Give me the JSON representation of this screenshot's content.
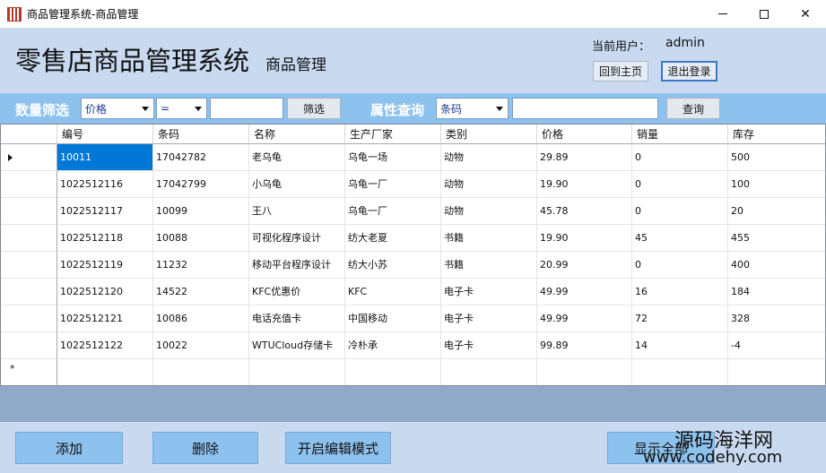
{
  "window": {
    "title": "商品管理系统-商品管理",
    "minimize_icon": "minimize-icon",
    "maximize_icon": "maximize-icon",
    "close_icon": "close-icon",
    "close_glyph": "✕"
  },
  "header": {
    "title": "零售店商品管理系统",
    "subtitle": "商品管理",
    "current_user_label": "当前用户：",
    "current_user": "admin",
    "home_button": "回到主页",
    "logout_button": "退出登录"
  },
  "filter": {
    "quantity_label": "数量筛选",
    "field_select": "价格",
    "operator_select": "=",
    "value": "",
    "filter_button": "筛选",
    "attribute_label": "属性查询",
    "attribute_select": "条码",
    "query_value": "",
    "query_button": "查询"
  },
  "grid": {
    "columns": [
      "编号",
      "条码",
      "名称",
      "生产厂家",
      "类别",
      "价格",
      "销量",
      "库存"
    ],
    "rows": [
      [
        "10011",
        "17042782",
        "老乌龟",
        "乌龟一场",
        "动物",
        "29.89",
        "0",
        "500"
      ],
      [
        "1022512116",
        "17042799",
        "小乌龟",
        "乌龟一厂",
        "动物",
        "19.90",
        "0",
        "100"
      ],
      [
        "1022512117",
        "10099",
        "王八",
        "乌龟一厂",
        "动物",
        "45.78",
        "0",
        "20"
      ],
      [
        "1022512118",
        "10088",
        "可视化程序设计",
        "纺大老夏",
        "书籍",
        "19.90",
        "45",
        "455"
      ],
      [
        "1022512119",
        "11232",
        "移动平台程序设计",
        "纺大小苏",
        "书籍",
        "20.99",
        "0",
        "400"
      ],
      [
        "1022512120",
        "14522",
        "KFC优惠价",
        "KFC",
        "电子卡",
        "49.99",
        "16",
        "184"
      ],
      [
        "1022512121",
        "10086",
        "电话充值卡",
        "中国移动",
        "电子卡",
        "49.99",
        "72",
        "328"
      ],
      [
        "1022512122",
        "10022",
        "WTUCloud存储卡",
        "冷朴承",
        "电子卡",
        "99.89",
        "14",
        "-4"
      ]
    ],
    "new_row_marker": "*"
  },
  "actions": {
    "add": "添加",
    "delete": "删除",
    "edit_mode": "开启编辑模式",
    "show_all": "显示全部"
  },
  "watermark": {
    "site_name": "源码海洋网",
    "site_url": "www.codehy.com"
  },
  "colors": {
    "header_bg": "#c9daf0",
    "filter_bg": "#8ec2ee",
    "selection": "#0078d7"
  }
}
